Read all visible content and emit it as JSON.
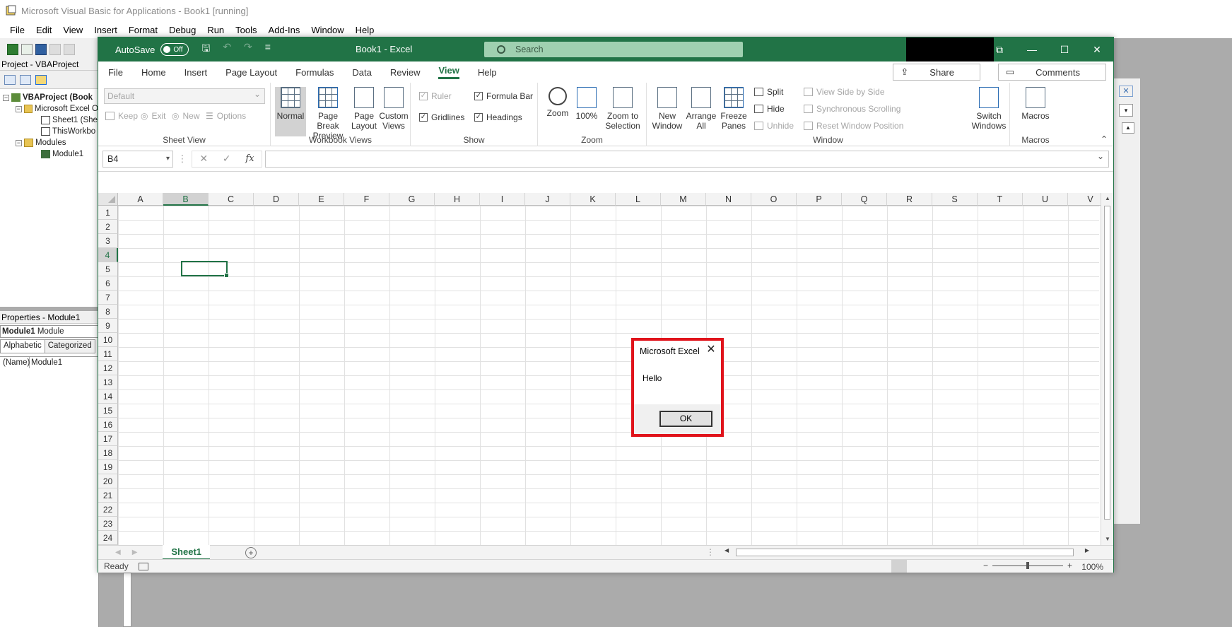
{
  "vba": {
    "title": "Microsoft Visual Basic for Applications - Book1 [running]",
    "menu": [
      "File",
      "Edit",
      "View",
      "Insert",
      "Format",
      "Debug",
      "Run",
      "Tools",
      "Add-Ins",
      "Window",
      "Help"
    ],
    "project_panel_title": "Project - VBAProject",
    "tree": {
      "root": "VBAProject (Book",
      "excel_objects": "Microsoft Excel O",
      "sheet1": "Sheet1 (She",
      "thisworkbook": "ThisWorkbo",
      "modules": "Modules",
      "module1": "Module1"
    },
    "properties_panel_title": "Properties - Module1",
    "props_combo_name": "Module1",
    "props_combo_type": "Module",
    "props_tabs": [
      "Alphabetic",
      "Categorized"
    ],
    "props_row_key": "(Name)",
    "props_row_value": "Module1"
  },
  "excel": {
    "autosave_label": "AutoSave",
    "autosave_state": "Off",
    "doc_title": "Book1  -  Excel",
    "search_placeholder": "Search",
    "ribbon_tabs": [
      "File",
      "Home",
      "Insert",
      "Page Layout",
      "Formulas",
      "Data",
      "Review",
      "View",
      "Help"
    ],
    "active_tab": "View",
    "share_label": "Share",
    "comments_label": "Comments",
    "sheet_view": {
      "style_default": "Default",
      "keep": "Keep",
      "exit": "Exit",
      "new": "New",
      "options": "Options",
      "label": "Sheet View"
    },
    "workbook_views": {
      "normal": "Normal",
      "page_break_1": "Page Break",
      "page_break_2": "Preview",
      "page_layout_1": "Page",
      "page_layout_2": "Layout",
      "custom_1": "Custom",
      "custom_2": "Views",
      "label": "Workbook Views"
    },
    "show": {
      "ruler": "Ruler",
      "formula_bar": "Formula Bar",
      "gridlines": "Gridlines",
      "headings": "Headings",
      "label": "Show"
    },
    "zoom": {
      "zoom": "Zoom",
      "hundred": "100%",
      "sel_1": "Zoom to",
      "sel_2": "Selection",
      "label": "Zoom"
    },
    "window": {
      "new_1": "New",
      "new_2": "Window",
      "arrange_1": "Arrange",
      "arrange_2": "All",
      "freeze_1": "Freeze",
      "freeze_2": "Panes",
      "split": "Split",
      "hide": "Hide",
      "unhide": "Unhide",
      "side_by_side": "View Side by Side",
      "sync_scroll": "Synchronous Scrolling",
      "reset_pos": "Reset Window Position",
      "switch_1": "Switch",
      "switch_2": "Windows",
      "label": "Window"
    },
    "macros": {
      "macros": "Macros",
      "label": "Macros"
    },
    "name_box": "B4",
    "fx": "fx",
    "columns": [
      "A",
      "B",
      "C",
      "D",
      "E",
      "F",
      "G",
      "H",
      "I",
      "J",
      "K",
      "L",
      "M",
      "N",
      "O",
      "P",
      "Q",
      "R",
      "S",
      "T",
      "U",
      "V"
    ],
    "rows": [
      "1",
      "2",
      "3",
      "4",
      "5",
      "6",
      "7",
      "8",
      "9",
      "10",
      "11",
      "12",
      "13",
      "14",
      "15",
      "16",
      "17",
      "18",
      "19",
      "20",
      "21",
      "22",
      "23",
      "24"
    ],
    "selected_col": "B",
    "selected_row": "4",
    "sheet_tab": "Sheet1",
    "status_ready": "Ready",
    "zoom_pct": "100%"
  },
  "msgbox": {
    "title": "Microsoft Excel",
    "message": "Hello",
    "ok": "OK",
    "highlight_color": "#e0131b"
  },
  "colors": {
    "excel_green": "#217346"
  }
}
